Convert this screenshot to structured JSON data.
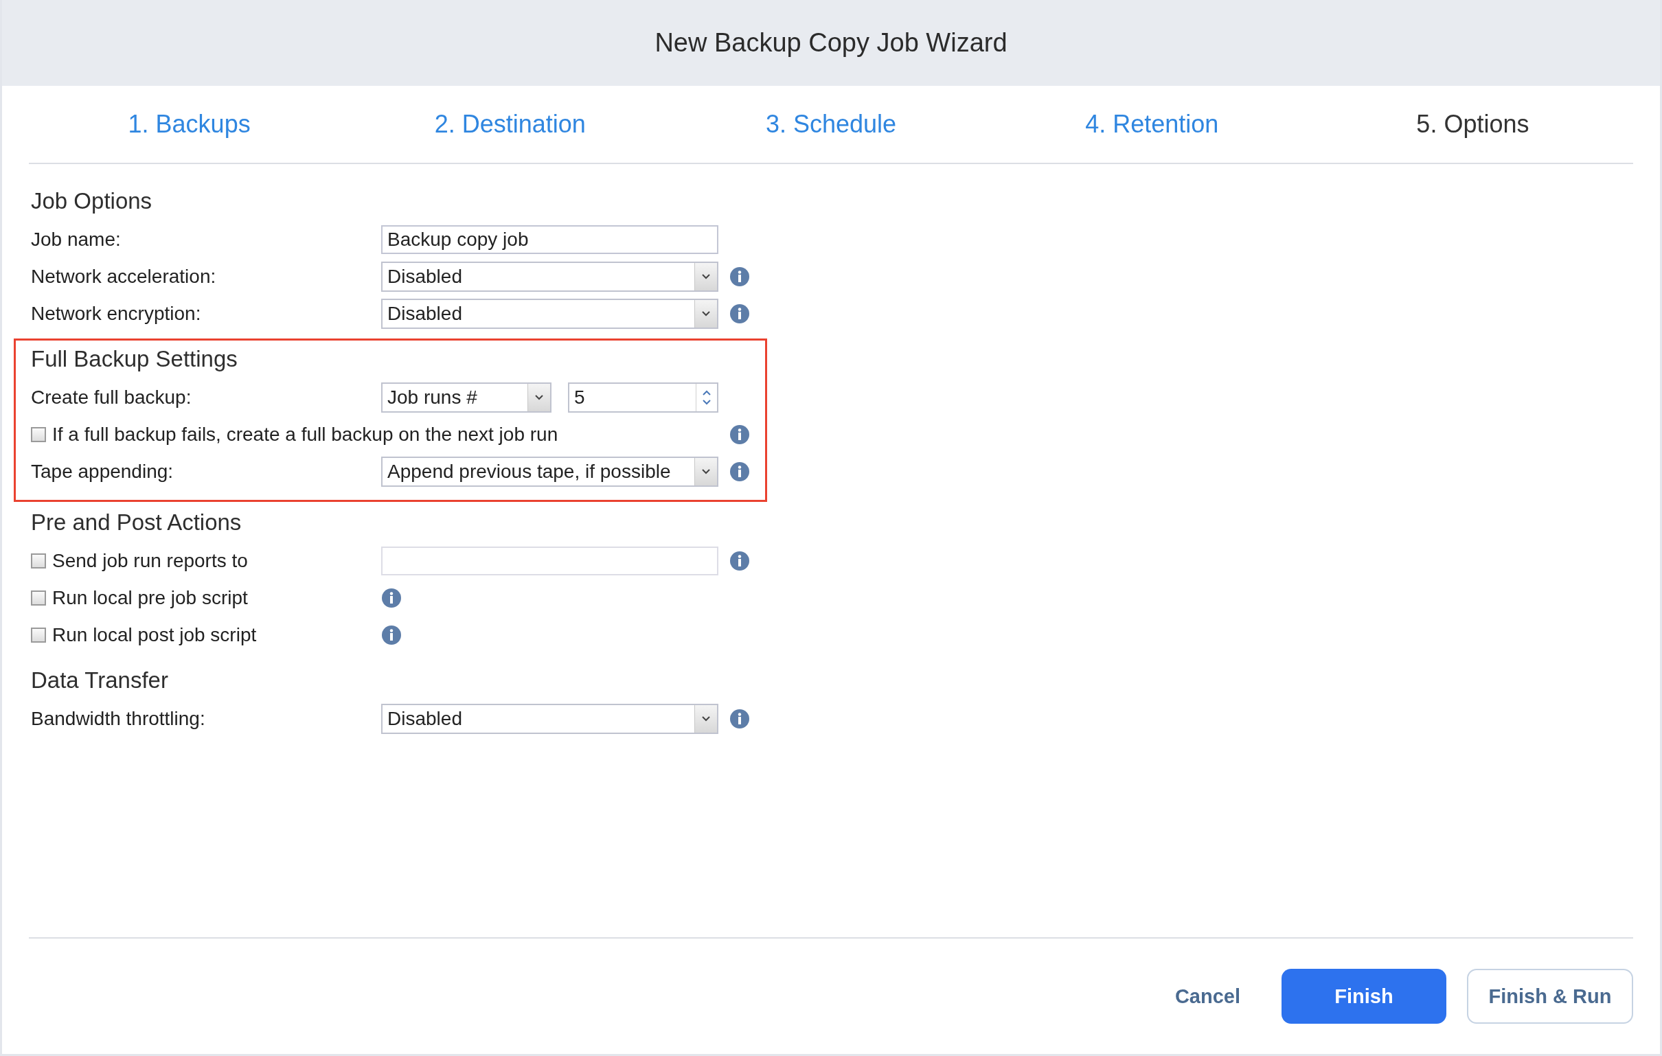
{
  "window": {
    "title": "New Backup Copy Job Wizard"
  },
  "tabs": [
    {
      "label": "1. Backups",
      "selected": false
    },
    {
      "label": "2. Destination",
      "selected": false
    },
    {
      "label": "3. Schedule",
      "selected": false
    },
    {
      "label": "4. Retention",
      "selected": false
    },
    {
      "label": "5. Options",
      "selected": true
    }
  ],
  "sections": [
    {
      "title": "Job Options",
      "highlighted": false,
      "rows": [
        {
          "kind": "text",
          "label": "Job name:",
          "value": "Backup copy job",
          "info": false
        },
        {
          "kind": "select",
          "label": "Network acceleration:",
          "value": "Disabled",
          "info": true
        },
        {
          "kind": "select",
          "label": "Network encryption:",
          "value": "Disabled",
          "info": true
        }
      ]
    },
    {
      "title": "Full Backup Settings",
      "highlighted": true,
      "rows": [
        {
          "kind": "select-spin",
          "label": "Create full backup:",
          "value": "Job runs #",
          "number": "5",
          "info": false
        },
        {
          "kind": "checkbox-wide",
          "label": "If a full backup fails, create a full backup on the next job run",
          "checked": false,
          "info": true
        },
        {
          "kind": "select",
          "label": "Tape appending:",
          "value": "Append previous tape, if possible",
          "info": true
        }
      ]
    },
    {
      "title": "Pre and Post Actions",
      "highlighted": false,
      "rows": [
        {
          "kind": "checkbox-field",
          "label": "Send job run reports to",
          "checked": false,
          "info": true
        },
        {
          "kind": "checkbox",
          "label": "Run local pre job script",
          "checked": false,
          "info": true
        },
        {
          "kind": "checkbox",
          "label": "Run local post job script",
          "checked": false,
          "info": true
        }
      ]
    },
    {
      "title": "Data Transfer",
      "highlighted": false,
      "rows": [
        {
          "kind": "select",
          "label": "Bandwidth throttling:",
          "value": "Disabled",
          "info": true
        }
      ]
    }
  ],
  "buttons": [
    {
      "label": "Cancel",
      "kind": "link"
    },
    {
      "label": "Finish",
      "kind": "primary"
    },
    {
      "label": "Finish & Run",
      "kind": "secondary"
    }
  ]
}
